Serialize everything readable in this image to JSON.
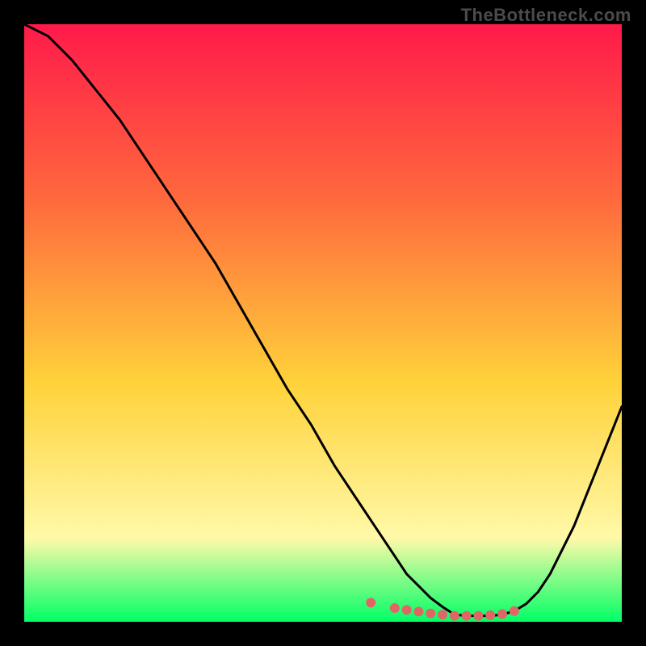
{
  "watermark": "TheBottleneck.com",
  "colors": {
    "background": "#000000",
    "gradient_top": "#ff1a4a",
    "gradient_mid_upper": "#ff6b3d",
    "gradient_mid": "#ffd23a",
    "gradient_lower": "#fff9a8",
    "gradient_bottom": "#00ff66",
    "curve": "#000000",
    "dots": "#e06666",
    "watermark": "#4b4b4b"
  },
  "chart_data": {
    "type": "line",
    "title": "",
    "xlabel": "",
    "ylabel": "",
    "xlim": [
      0,
      100
    ],
    "ylim": [
      0,
      100
    ],
    "note": "V-shaped bottleneck curve: value ≈ |x − optimum| scaled; low values near optimum (green band), high values far from optimum (red band). Axis scales are estimated from the shape since no tick labels are shown.",
    "optimum_x": 72,
    "series": [
      {
        "name": "curve",
        "x": [
          0,
          4,
          8,
          12,
          16,
          20,
          24,
          28,
          32,
          36,
          40,
          44,
          48,
          52,
          56,
          58,
          60,
          62,
          64,
          66,
          68,
          70,
          72,
          74,
          76,
          78,
          80,
          82,
          84,
          86,
          88,
          90,
          92,
          94,
          96,
          98,
          100
        ],
        "y": [
          100,
          98,
          94,
          89,
          84,
          78,
          72,
          66,
          60,
          53,
          46,
          39,
          33,
          26,
          20,
          17,
          14,
          11,
          8,
          6,
          4,
          2.5,
          1.2,
          1.0,
          1.0,
          1.0,
          1.2,
          1.8,
          3,
          5,
          8,
          12,
          16,
          21,
          26,
          31,
          36
        ]
      }
    ],
    "dots": {
      "name": "optimum-markers",
      "x": [
        58,
        62,
        64,
        66,
        68,
        70,
        72,
        74,
        76,
        78,
        80,
        82
      ],
      "y": [
        3.2,
        2.3,
        2.0,
        1.7,
        1.4,
        1.2,
        1.0,
        1.0,
        1.0,
        1.1,
        1.3,
        1.8
      ]
    }
  }
}
